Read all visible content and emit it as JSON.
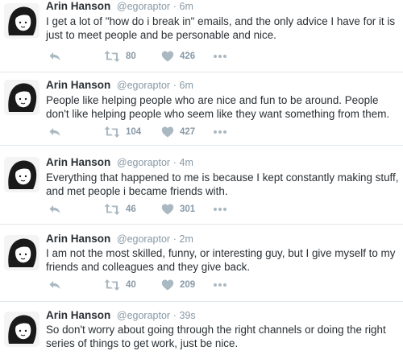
{
  "tweets": [
    {
      "name": "Arin Hanson",
      "handle": "@egoraptor",
      "sep": "·",
      "time": "6m",
      "text": "I get a lot of \"how do i break in\" emails, and the only advice I have for it is just to meet people and be personable and nice.",
      "retweets": "80",
      "likes": "426"
    },
    {
      "name": "Arin Hanson",
      "handle": "@egoraptor",
      "sep": "·",
      "time": "6m",
      "text": "People like helping people who are nice and fun to be around. People don't like helping people who seem like they want something from them.",
      "retweets": "104",
      "likes": "427"
    },
    {
      "name": "Arin Hanson",
      "handle": "@egoraptor",
      "sep": "·",
      "time": "4m",
      "text": "Everything that happened to me is because I kept constantly making stuff, and met people i became friends with.",
      "retweets": "46",
      "likes": "301"
    },
    {
      "name": "Arin Hanson",
      "handle": "@egoraptor",
      "sep": "·",
      "time": "2m",
      "text": "I am not the most skilled, funny, or interesting guy, but I give myself to my friends and colleagues and they give back.",
      "retweets": "40",
      "likes": "209"
    },
    {
      "name": "Arin Hanson",
      "handle": "@egoraptor",
      "sep": "·",
      "time": "39s",
      "text": "So don't worry about going through the right channels or doing the right series of things to get work, just be nice.",
      "retweets": "",
      "likes": ""
    }
  ],
  "icons": {
    "reply": "reply-icon",
    "retweet": "retweet-icon",
    "like": "heart-icon",
    "more": "more-icon",
    "avatar": "avatar"
  },
  "colors": {
    "name": "#292f33",
    "meta": "#8899a6",
    "icon": "#aab8c2"
  }
}
